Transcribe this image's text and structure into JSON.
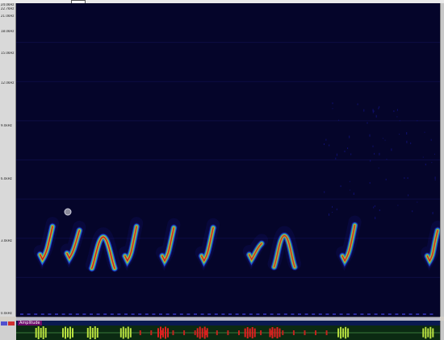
{
  "window": {
    "title": ""
  },
  "frequency_axis": {
    "tick_labels": [
      "24.0kHz",
      "22.7kHz",
      "21.0kHz",
      "18.0kHz",
      "15.0kHz",
      "12.0kHz",
      "9.0kHz",
      "6.0kHz",
      "3.0kHz",
      "0.0kHz"
    ]
  },
  "spectrogram": {
    "palette": [
      "#1a1aa8",
      "#2a6ae0",
      "#22c8c8",
      "#7ae028",
      "#f0e020",
      "#f08010",
      "#e01818"
    ],
    "background": "#05052a",
    "selection_marker": "gray-circle-marker",
    "calls": [
      {
        "kind": "chirp",
        "time": 0.05,
        "freq_low": 4.5,
        "freq_high": 6.9,
        "duration": 0.03,
        "intensity": 1.0
      },
      {
        "kind": "chirp",
        "time": 0.115,
        "freq_low": 4.6,
        "freq_high": 6.6,
        "duration": 0.03,
        "intensity": 0.9
      },
      {
        "kind": "arch",
        "time": 0.175,
        "freq_low": 3.7,
        "freq_high": 6.1,
        "duration": 0.055,
        "intensity": 1.0
      },
      {
        "kind": "chirp",
        "time": 0.255,
        "freq_low": 4.4,
        "freq_high": 6.9,
        "duration": 0.028,
        "intensity": 0.9
      },
      {
        "kind": "chirp",
        "time": 0.345,
        "freq_low": 4.4,
        "freq_high": 6.8,
        "duration": 0.028,
        "intensity": 0.9
      },
      {
        "kind": "chirp",
        "time": 0.44,
        "freq_low": 4.4,
        "freq_high": 6.8,
        "duration": 0.028,
        "intensity": 0.9
      },
      {
        "kind": "chirp",
        "time": 0.555,
        "freq_low": 4.5,
        "freq_high": 5.6,
        "duration": 0.03,
        "intensity": 0.8
      },
      {
        "kind": "arch",
        "time": 0.615,
        "freq_low": 3.8,
        "freq_high": 6.2,
        "duration": 0.05,
        "intensity": 0.8
      },
      {
        "kind": "chirp",
        "time": 0.78,
        "freq_low": 4.4,
        "freq_high": 7.0,
        "duration": 0.03,
        "intensity": 0.85
      },
      {
        "kind": "chirp",
        "time": 0.985,
        "freq_low": 4.4,
        "freq_high": 6.6,
        "duration": 0.025,
        "intensity": 0.85
      }
    ]
  },
  "waveform": {
    "title": "Amplitude",
    "side_label": "",
    "colors": {
      "normal": "#b8e040",
      "clipped": "#e02020",
      "axis": "#3a7a3a"
    },
    "clipped_range": [
      0.29,
      0.74
    ]
  }
}
